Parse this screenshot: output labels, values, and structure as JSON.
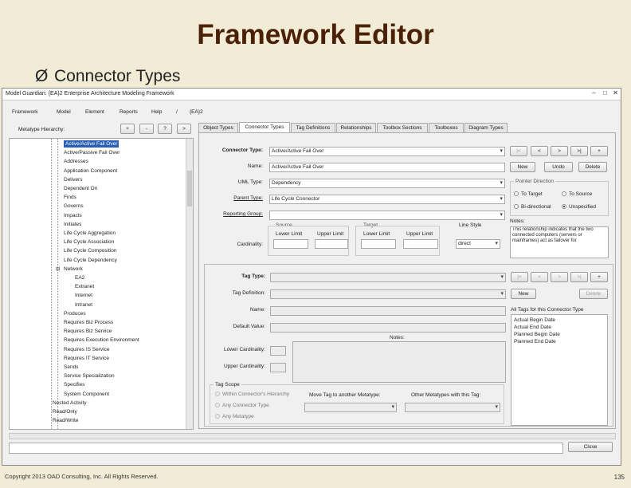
{
  "slide": {
    "title": "Framework Editor",
    "bullet_glyph": "Ø",
    "bullet_text": "Connector Types",
    "footer": "Copyright 2013 OAD Consulting, Inc. All Rights Reserved.",
    "page_number": "135"
  },
  "window": {
    "title": "Model Guardian: {EA}2 Enterprise Architecture Modeling Framework",
    "controls": [
      "–",
      "□",
      "✕"
    ],
    "menus": [
      "Framework",
      "Model",
      "Element",
      "Reports",
      "Help",
      "/",
      "{EA}2"
    ]
  },
  "left_panel": {
    "label": "Metatype Hierarchy:",
    "buttons": [
      "+",
      "-",
      "?",
      ">"
    ],
    "tree": [
      {
        "text": "Active/Active Fail Over",
        "selected": true
      },
      {
        "text": "Active/Passive Fail Over"
      },
      {
        "text": "Addresses"
      },
      {
        "text": "Application Component"
      },
      {
        "text": "Delivers"
      },
      {
        "text": "Dependent On"
      },
      {
        "text": "Finds"
      },
      {
        "text": "Governs"
      },
      {
        "text": "Impacts"
      },
      {
        "text": "Initiates"
      },
      {
        "text": "Life Cycle Aggregation"
      },
      {
        "text": "Life Cycle Association"
      },
      {
        "text": "Life Cycle Composition"
      },
      {
        "text": "Life Cycle Dependency"
      },
      {
        "text": "Network",
        "expander": "⊟"
      },
      {
        "text": "EA2",
        "child": true
      },
      {
        "text": "Extranet",
        "child": true
      },
      {
        "text": "Internet",
        "child": true
      },
      {
        "text": "Intranet",
        "child": true
      },
      {
        "text": "Produces"
      },
      {
        "text": "Requires Biz Process"
      },
      {
        "text": "Requires Biz Service"
      },
      {
        "text": "Requires Execution Environment"
      },
      {
        "text": "Requires IS Service"
      },
      {
        "text": "Requires IT Service"
      },
      {
        "text": "Sends"
      },
      {
        "text": "Service Specialization"
      },
      {
        "text": "Specifies"
      },
      {
        "text": "System Component"
      },
      {
        "text": "Nested Activity",
        "root": true
      },
      {
        "text": "Read/Only",
        "root": true
      },
      {
        "text": "Read/Write",
        "root": true
      }
    ]
  },
  "tabs": [
    "Object Types",
    "Connector Types",
    "Tag Definitions",
    "Relationships",
    "Toolbox Sections",
    "Toolboxes",
    "Diagram Types"
  ],
  "connector": {
    "connector_type_label": "Connector Type:",
    "connector_type_value": "Active/Active Fail Over",
    "nav_buttons": [
      "|<",
      "<",
      ">",
      ">|",
      "+"
    ],
    "name_label": "Name:",
    "name_value": "Active/Active Fail Over",
    "new_btn": "New",
    "undo_btn": "Undo",
    "delete_btn": "Delete",
    "uml_type_label": "UML Type:",
    "uml_type_value": "Dependency",
    "parent_type_label": "Parent Type:",
    "parent_type_value": "Life Cycle Connector",
    "reporting_group_label": "Reporting Group:",
    "reporting_group_value": "",
    "pointer_direction_label": "Pointer Direction",
    "directions": [
      {
        "text": "To Target",
        "on": false
      },
      {
        "text": "To Source",
        "on": false
      },
      {
        "text": "Bi-directional",
        "on": false
      },
      {
        "text": "Unspecified",
        "on": true
      }
    ],
    "source_label": "Source",
    "target_label": "Target",
    "line_style_label": "Line Style",
    "lower_limit_label": "Lower Limit",
    "upper_limit_label": "Upper Limit",
    "cardinality_label": "Cardinality:",
    "line_style_value": "direct",
    "notes_label": "Notes:",
    "notes_text": "This relationship indicates that the two connected computers (servers or mainframes) act as failover for"
  },
  "tag": {
    "tag_type_label": "Tag Type:",
    "tag_definition_label": "Tag Definition:",
    "name_label": "Name:",
    "default_value_label": "Default Value:",
    "notes_label": "Notes:",
    "lower_cardinality_label": "Lower Cardinality:",
    "upper_cardinality_label": "Upper Cardinality:",
    "nav_buttons": [
      "|<",
      "<",
      ">",
      ">|",
      "+"
    ],
    "new_btn": "New",
    "delete_btn": "Delete",
    "all_tags_label": "All Tags for this Connector Type",
    "all_tags": [
      "Actual Begin Date",
      "Actual End Date",
      "Planned Begin Date",
      "Planned End Date"
    ],
    "scope_label": "Tag Scope",
    "scope_options": [
      "Within Connector's Hierarchy",
      "Any Connector Type",
      "Any Metatype"
    ],
    "move_label": "Move Tag to another Metatype:",
    "other_label": "Other Metatypes with this Tag:",
    "close_btn": "Close"
  },
  "colors": {
    "slide_bg": "#f2ecd7",
    "title": "#4a2107",
    "selection": "#2b5fb5"
  }
}
